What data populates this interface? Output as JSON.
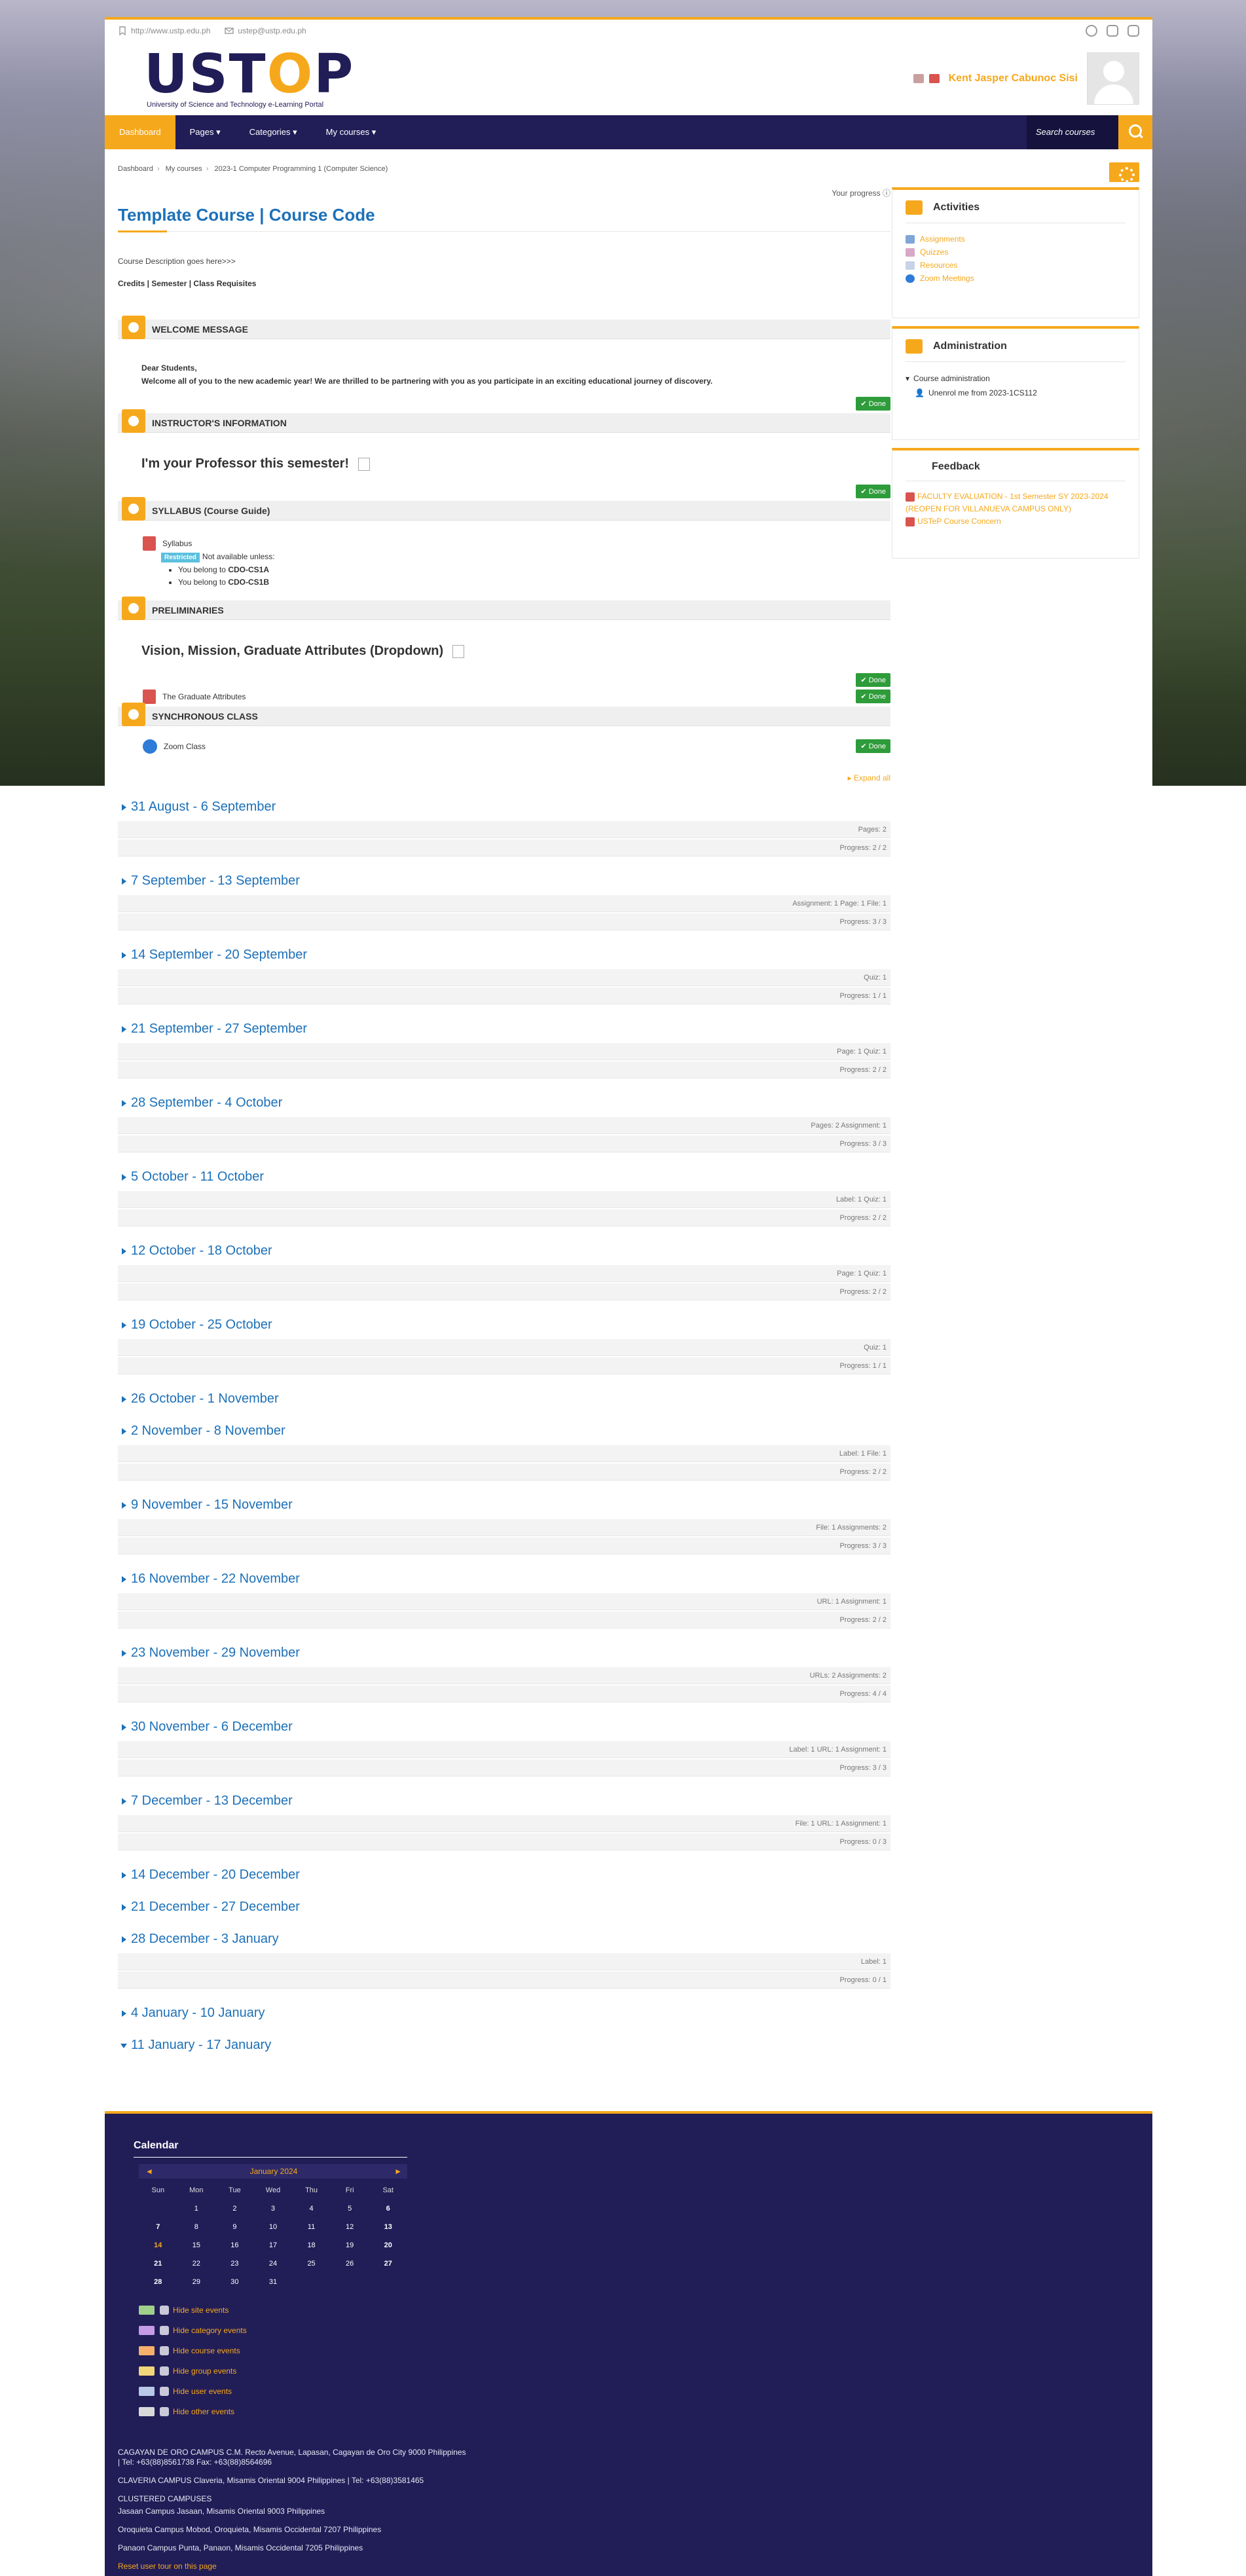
{
  "topbar": {
    "website": "http://www.ustp.edu.ph",
    "email": "ustep@ustp.edu.ph"
  },
  "brand": {
    "logo_prefix": "UST",
    "logo_o": "O",
    "logo_suffix": "P",
    "logo_sub": "University of Science and Technology e-Learning Portal"
  },
  "user": {
    "name": "Kent Jasper Cabunoc Sisi"
  },
  "nav": {
    "items": [
      "Dashboard",
      "Pages",
      "Categories",
      "My courses"
    ],
    "search_placeholder": "Search courses"
  },
  "breadcrumb": [
    "Dashboard",
    "My courses",
    "2023-1 Computer Programming 1 (Computer Science)"
  ],
  "course": {
    "progress_label": "Your progress",
    "title": "Template Course | Course Code",
    "description": "Course Description goes here>>>",
    "meta": "Credits | Semester  | Class Requisites"
  },
  "sections": {
    "welcome": {
      "title": "WELCOME MESSAGE",
      "line1": "Dear Students,",
      "line2": "Welcome all of you to the new academic year! We are thrilled to be partnering with you as you participate in an exciting educational journey of discovery.",
      "done": "Done"
    },
    "instructor": {
      "title": "INSTRUCTOR'S INFORMATION",
      "heading": "I'm your Professor this semester!",
      "done": "Done"
    },
    "syllabus": {
      "title": "SYLLABUS (Course Guide)",
      "activity": "Syllabus",
      "restricted_tag": "Restricted",
      "restricted_text": "Not available unless:",
      "cond1_prefix": "You belong to",
      "cond1_value": "CDO-CS1A",
      "cond2_prefix": "You belong to",
      "cond2_value": "CDO-CS1B"
    },
    "preliminaries": {
      "title": "PRELIMINARIES",
      "heading": "Vision, Mission, Graduate Attributes (Dropdown)",
      "activity": "The Graduate Attributes",
      "done": "Done"
    },
    "synchronous": {
      "title": "SYNCHRONOUS CLASS",
      "activity": "Zoom Class",
      "done": "Done"
    }
  },
  "expand_all": "Expand all",
  "weeks": [
    {
      "title": "31 August - 6 September",
      "summary": "Pages: 2",
      "progress": "Progress: 2 / 2"
    },
    {
      "title": "7 September - 13 September",
      "summary": "Assignment: 1  Page: 1  File: 1",
      "progress": "Progress: 3 / 3"
    },
    {
      "title": "14 September - 20 September",
      "summary": "Quiz: 1",
      "progress": "Progress: 1 / 1"
    },
    {
      "title": "21 September - 27 September",
      "summary": "Page: 1  Quiz: 1",
      "progress": "Progress: 2 / 2"
    },
    {
      "title": "28 September - 4 October",
      "summary": "Pages: 2  Assignment: 1",
      "progress": "Progress: 3 / 3"
    },
    {
      "title": "5 October - 11 October",
      "summary": "Label: 1  Quiz: 1",
      "progress": "Progress: 2 / 2"
    },
    {
      "title": "12 October - 18 October",
      "summary": "Page: 1  Quiz: 1",
      "progress": "Progress: 2 / 2"
    },
    {
      "title": "19 October - 25 October",
      "summary": "Quiz: 1",
      "progress": "Progress: 1 / 1"
    },
    {
      "title": "26 October - 1 November",
      "summary": "",
      "progress": ""
    },
    {
      "title": "2 November - 8 November",
      "summary": "Label: 1  File: 1",
      "progress": "Progress: 2 / 2"
    },
    {
      "title": "9 November - 15 November",
      "summary": "File: 1  Assignments: 2",
      "progress": "Progress: 3 / 3"
    },
    {
      "title": "16 November - 22 November",
      "summary": "URL: 1  Assignment: 1",
      "progress": "Progress: 2 / 2"
    },
    {
      "title": "23 November - 29 November",
      "summary": "URLs: 2  Assignments: 2",
      "progress": "Progress: 4 / 4"
    },
    {
      "title": "30 November - 6 December",
      "summary": "Label: 1  URL: 1  Assignment: 1",
      "progress": "Progress: 3 / 3"
    },
    {
      "title": "7 December - 13 December",
      "summary": "File: 1  URL: 1  Assignment: 1",
      "progress": "Progress: 0 / 3"
    },
    {
      "title": "14 December - 20 December",
      "summary": "",
      "progress": ""
    },
    {
      "title": "21 December - 27 December",
      "summary": "",
      "progress": ""
    },
    {
      "title": "28 December - 3 January",
      "summary": "Label: 1",
      "progress": "Progress: 0 / 1"
    },
    {
      "title": "4 January - 10 January",
      "summary": "",
      "progress": ""
    },
    {
      "title": "11 January - 17 January",
      "summary": "",
      "progress": ""
    }
  ],
  "sidebar": {
    "activities": {
      "title": "Activities",
      "links": [
        "Assignments",
        "Quizzes",
        "Resources",
        "Zoom Meetings"
      ]
    },
    "administration": {
      "title": "Administration",
      "item1": "Course administration",
      "item2": "Unenrol me from 2023-1CS112"
    },
    "feedback": {
      "title": "Feedback",
      "link1": "FACULTY EVALUATION - 1st Semester SY 2023-2024 (REOPEN FOR VILLANUEVA CAMPUS ONLY)",
      "link2": "USTeP Course Concern"
    }
  },
  "calendar": {
    "title": "Calendar",
    "prev": "◄",
    "month": "January 2024",
    "next": "►",
    "day_names": [
      "Sun",
      "Mon",
      "Tue",
      "Wed",
      "Thu",
      "Fri",
      "Sat"
    ],
    "weeks": [
      [
        "",
        "1",
        "2",
        "3",
        "4",
        "5",
        "6"
      ],
      [
        "7",
        "8",
        "9",
        "10",
        "11",
        "12",
        "13"
      ],
      [
        "14",
        "15",
        "16",
        "17",
        "18",
        "19",
        "20"
      ],
      [
        "21",
        "22",
        "23",
        "24",
        "25",
        "26",
        "27"
      ],
      [
        "28",
        "29",
        "30",
        "31",
        "",
        "",
        ""
      ]
    ],
    "today": "14",
    "legend": [
      {
        "label": "Hide site events",
        "color": "#9fd08b"
      },
      {
        "label": "Hide category events",
        "color": "#c59be6"
      },
      {
        "label": "Hide course events",
        "color": "#f6b06b"
      },
      {
        "label": "Hide group events",
        "color": "#f2d67a"
      },
      {
        "label": "Hide user events",
        "color": "#b9c8e8"
      },
      {
        "label": "Hide other events",
        "color": "#d9d9d9"
      }
    ]
  },
  "footer": {
    "cdo": "CAGAYAN DE ORO CAMPUS C.M. Recto Avenue, Lapasan, Cagayan de Oro City 9000 Philippines",
    "cdo_tel": "| Tel: +63(88)8561738 Fax: +63(88)8564696",
    "claveria": "CLAVERIA CAMPUS Claveria, Misamis Oriental 9004 Philippines  | Tel: +63(88)3581465",
    "clustered": "CLUSTERED CAMPUSES",
    "jasaan": "Jasaan Campus Jasaan, Misamis Oriental 9003 Philippines",
    "oroquieta": "Oroquieta Campus Mobod, Oroquieta, Misamis Occidental 7207 Philippines",
    "panaon": "Panaon Campus Punta, Panaon, Misamis Occidental 7205 Philippines",
    "tour": "Reset user tour on this page"
  }
}
